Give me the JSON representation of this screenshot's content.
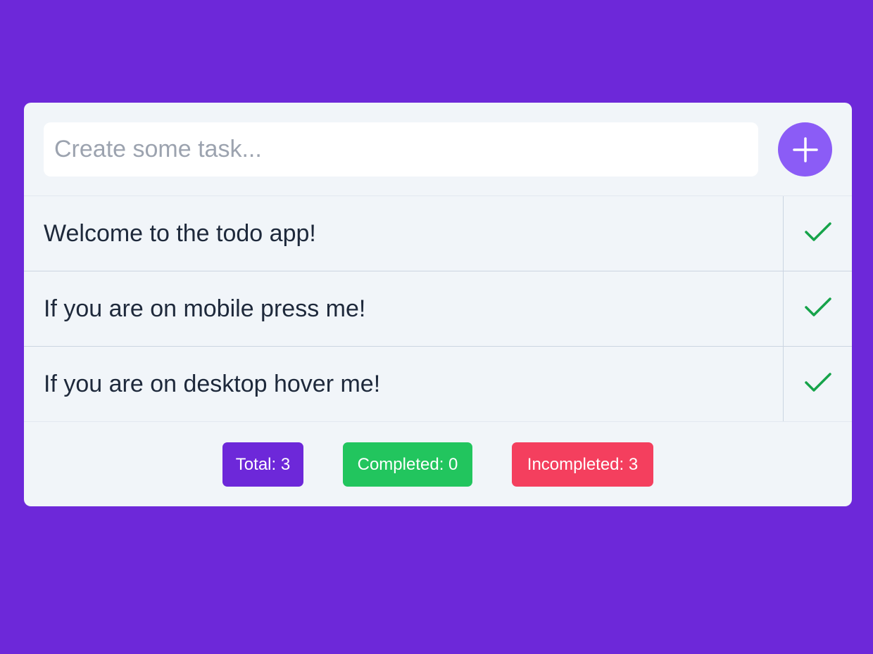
{
  "input": {
    "placeholder": "Create some task...",
    "value": ""
  },
  "add_button": {
    "icon": "plus-icon"
  },
  "tasks": [
    {
      "text": "Welcome to the todo app!",
      "completed": false,
      "action_icon": "check-icon"
    },
    {
      "text": "If you are on mobile press me!",
      "completed": false,
      "action_icon": "check-icon"
    },
    {
      "text": "If you are on desktop hover me!",
      "completed": false,
      "action_icon": "check-icon"
    }
  ],
  "stats": {
    "total": "Total: 3",
    "completed": "Completed: 0",
    "incompleted": "Incompleted: 3"
  },
  "colors": {
    "background": "#6d28d9",
    "card": "#f1f5f9",
    "accent": "#8b5cf6",
    "check": "#16a34a",
    "completed_badge": "#22c55e",
    "incompleted_badge": "#f43f5e"
  }
}
